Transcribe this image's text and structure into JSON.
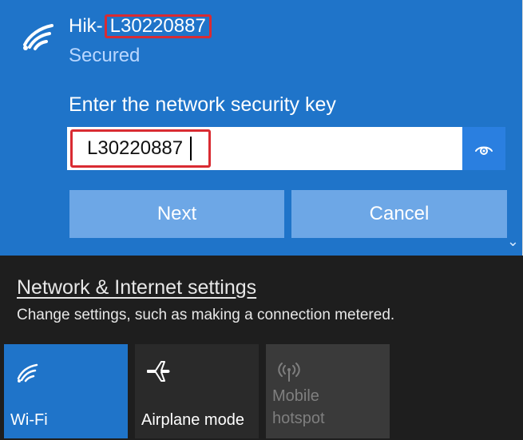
{
  "network": {
    "name_prefix": "Hik-",
    "name_key": "L30220887",
    "status": "Secured",
    "prompt": "Enter the network security key",
    "security_key": "L30220887",
    "icons": {
      "wifi": "wifi-icon",
      "reveal": "eye-icon",
      "chevron": "chevron-down-icon"
    },
    "buttons": {
      "next": "Next",
      "cancel": "Cancel"
    }
  },
  "settings": {
    "link_label": "Network & Internet settings",
    "description": "Change settings, such as making a connection metered."
  },
  "quick_actions": [
    {
      "label": "Wi-Fi",
      "icon": "wifi-icon",
      "state": "on"
    },
    {
      "label": "Airplane mode",
      "icon": "airplane-icon",
      "state": "off"
    },
    {
      "label_line1": "Mobile",
      "label_line2": "hotspot",
      "icon": "hotspot-icon",
      "state": "disabled"
    }
  ],
  "colors": {
    "accent_blue": "#1f74c9",
    "button_blue": "#6da7e6",
    "highlight_red": "#d92b32",
    "dark_background": "#1e1e1e"
  }
}
